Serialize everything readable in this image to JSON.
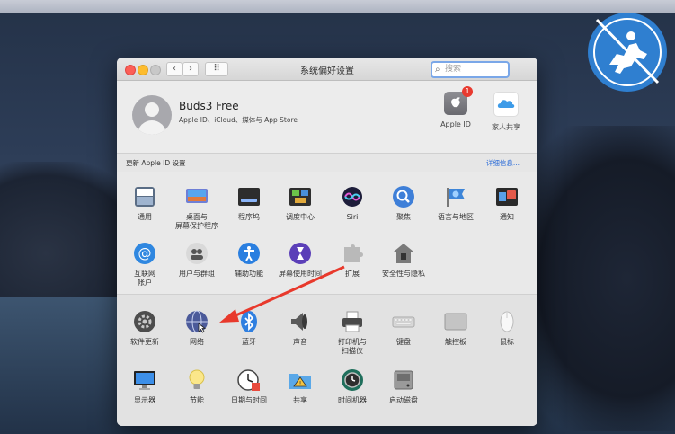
{
  "window": {
    "title": "系统偏好设置",
    "search_placeholder": "搜索",
    "nav": {
      "back": "‹",
      "forward": "›",
      "grid": "⠿"
    }
  },
  "profile": {
    "name": "Buds3 Free",
    "subtitle": "Apple ID、iCloud、媒体与 App Store",
    "apple_id": {
      "label": "Apple ID",
      "badge": "1"
    },
    "family": {
      "label": "家人共享"
    }
  },
  "update_bar": {
    "left": "更新 Apple ID 设置",
    "right": "详细信息..."
  },
  "panes_row1": [
    {
      "id": "general",
      "label": "通用",
      "icon": "general-icon"
    },
    {
      "id": "desktop",
      "label": "桌面与\n屏幕保护程序",
      "icon": "desktop-icon"
    },
    {
      "id": "dock",
      "label": "程序坞",
      "icon": "dock-icon"
    },
    {
      "id": "mission",
      "label": "调度中心",
      "icon": "mission-control-icon"
    },
    {
      "id": "siri",
      "label": "Siri",
      "icon": "siri-icon"
    },
    {
      "id": "spotlight",
      "label": "聚焦",
      "icon": "spotlight-icon"
    },
    {
      "id": "language",
      "label": "语言与地区",
      "icon": "language-icon"
    },
    {
      "id": "notifications",
      "label": "通知",
      "icon": "notifications-icon"
    }
  ],
  "panes_row2": [
    {
      "id": "internet",
      "label": "互联网\n帐户",
      "icon": "internet-accounts-icon"
    },
    {
      "id": "users",
      "label": "用户与群组",
      "icon": "users-icon"
    },
    {
      "id": "accessibility",
      "label": "辅助功能",
      "icon": "accessibility-icon"
    },
    {
      "id": "screentime",
      "label": "屏幕使用时间",
      "icon": "screen-time-icon"
    },
    {
      "id": "extensions",
      "label": "扩展",
      "icon": "extensions-icon"
    },
    {
      "id": "security",
      "label": "安全性与隐私",
      "icon": "security-icon"
    }
  ],
  "panes_row3": [
    {
      "id": "software",
      "label": "软件更新",
      "icon": "software-update-icon"
    },
    {
      "id": "network",
      "label": "网络",
      "icon": "network-icon"
    },
    {
      "id": "bluetooth",
      "label": "蓝牙",
      "icon": "bluetooth-icon"
    },
    {
      "id": "sound",
      "label": "声音",
      "icon": "sound-icon"
    },
    {
      "id": "printers",
      "label": "打印机与\n扫描仪",
      "icon": "printer-icon"
    },
    {
      "id": "keyboard",
      "label": "键盘",
      "icon": "keyboard-icon"
    },
    {
      "id": "trackpad",
      "label": "触控板",
      "icon": "trackpad-icon"
    },
    {
      "id": "mouse",
      "label": "鼠标",
      "icon": "mouse-icon"
    }
  ],
  "panes_row4": [
    {
      "id": "displays",
      "label": "显示器",
      "icon": "displays-icon"
    },
    {
      "id": "energy",
      "label": "节能",
      "icon": "energy-icon"
    },
    {
      "id": "datetime",
      "label": "日期与时间",
      "icon": "date-time-icon"
    },
    {
      "id": "sharing",
      "label": "共享",
      "icon": "sharing-icon"
    },
    {
      "id": "timemachine",
      "label": "时间机器",
      "icon": "time-machine-icon"
    },
    {
      "id": "startup",
      "label": "启动磁盘",
      "icon": "startup-disk-icon"
    }
  ],
  "colors": {
    "accent": "#2a6bd8",
    "arrow": "#e8392c",
    "logo": "#2f7fd0"
  }
}
